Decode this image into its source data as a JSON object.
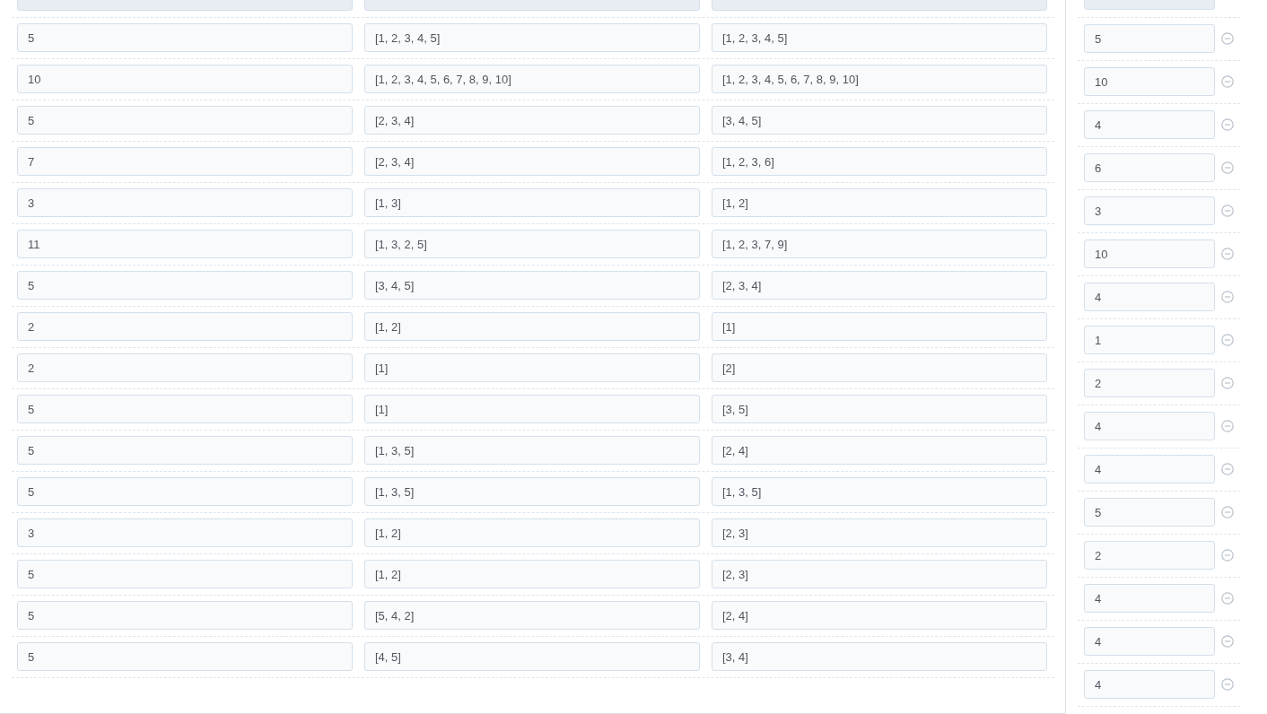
{
  "partial_top_row": {
    "disabled": true
  },
  "left_rows": [
    {
      "cells": [
        "5",
        "[1, 2, 3, 4, 5]",
        "[1, 2, 3, 4, 5]"
      ]
    },
    {
      "cells": [
        "10",
        "[1, 2, 3, 4, 5, 6, 7, 8, 9, 10]",
        "[1, 2, 3, 4, 5, 6, 7, 8, 9, 10]"
      ]
    },
    {
      "cells": [
        "5",
        "[2, 3, 4]",
        "[3, 4, 5]"
      ]
    },
    {
      "cells": [
        "7",
        "[2, 3, 4]",
        "[1, 2, 3, 6]"
      ]
    },
    {
      "cells": [
        "3",
        "[1, 3]",
        "[1, 2]"
      ]
    },
    {
      "cells": [
        "11",
        "[1, 3, 2, 5]",
        "[1, 2, 3, 7, 9]"
      ]
    },
    {
      "cells": [
        "5",
        "[3, 4, 5]",
        "[2, 3, 4]"
      ]
    },
    {
      "cells": [
        "2",
        "[1, 2]",
        "[1]"
      ]
    },
    {
      "cells": [
        "2",
        "[1]",
        "[2]"
      ]
    },
    {
      "cells": [
        "5",
        "[1]",
        "[3, 5]"
      ]
    },
    {
      "cells": [
        "5",
        "[1, 3, 5]",
        "[2, 4]"
      ]
    },
    {
      "cells": [
        "5",
        "[1, 3, 5]",
        "[1, 3, 5]"
      ]
    },
    {
      "cells": [
        "3",
        "[1, 2]",
        "[2, 3]"
      ]
    },
    {
      "cells": [
        "5",
        "[1, 2]",
        "[2, 3]"
      ]
    },
    {
      "cells": [
        "5",
        "[5, 4, 2]",
        "[2, 4]"
      ]
    },
    {
      "cells": [
        "5",
        "[4, 5]",
        "[3, 4]"
      ]
    }
  ],
  "right_rows": [
    {
      "value": "5"
    },
    {
      "value": "10"
    },
    {
      "value": "4"
    },
    {
      "value": "6"
    },
    {
      "value": "3"
    },
    {
      "value": "10"
    },
    {
      "value": "4"
    },
    {
      "value": "1"
    },
    {
      "value": "2"
    },
    {
      "value": "4"
    },
    {
      "value": "4"
    },
    {
      "value": "5"
    },
    {
      "value": "2"
    },
    {
      "value": "4"
    },
    {
      "value": "4"
    },
    {
      "value": "4"
    }
  ]
}
